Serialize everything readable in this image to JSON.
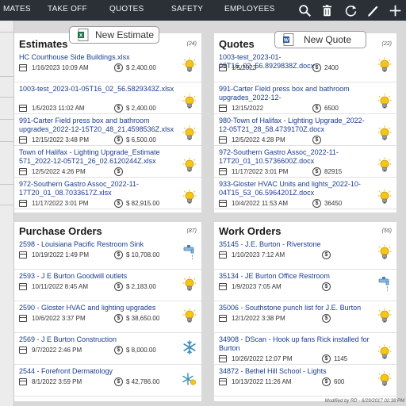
{
  "nav": {
    "tabs": [
      "MATES",
      "TAKE OFF",
      "QUOTES",
      "SAFETY",
      "EMPLOYEES"
    ],
    "icons": [
      "search-icon",
      "trash-icon",
      "refresh-icon",
      "pencil-icon",
      "plus-icon"
    ]
  },
  "estimates": {
    "title": "Estimates",
    "count": "(24)",
    "new_label": "New Estimate",
    "items": [
      {
        "title": "HC Courthouse Side Buildings.xlsx",
        "date": "1/16/2023 10:09 AM",
        "amount": "$ 2,400.00",
        "status": "lightbulb"
      },
      {
        "title": "1003-test_2023-01-05T16_02_56.5829343Z.xlsx",
        "date": "1/5/2023 11:02 AM",
        "amount": "$ 2,400.00",
        "status": "lightbulb"
      },
      {
        "title": "991-Carter Field press box and bathroom upgrades_2022-12-15T20_48_21.4598536Z.xlsx",
        "date": "12/15/2022 3:48 PM",
        "amount": "$ 6,500.00",
        "status": "lightbulb"
      },
      {
        "title": "Town of Halifax - Lighting Upgrade_Estimate 571_2022-12-05T21_26_02.6120244Z.xlsx",
        "date": "12/5/2022 4:26 PM",
        "amount": "",
        "status": "lightbulb"
      },
      {
        "title": "972-Southern Gastro Assoc_2022-11-17T20_01_08.7033617Z.xlsx",
        "date": "11/17/2022 3:01 PM",
        "amount": "$ 82,915.00",
        "status": "lightbulb"
      }
    ]
  },
  "quotes": {
    "title": "Quotes",
    "count": "(22)",
    "new_label": "New Quote",
    "items": [
      {
        "title": "1003-test_2023-01-05T16_02_56.8929838Z.docx",
        "date": "1/5/2023",
        "amount": "2400",
        "status": "lightbulb"
      },
      {
        "title": "991-Carter Field press box and bathroom upgrades_2022-12-15T20_48_21.4008509Z.docx",
        "date": "12/15/2022",
        "amount": "6500",
        "status": "lightbulb"
      },
      {
        "title": "980-Town of Halifax - Lighting Upgrade_2022-12-05T21_28_58.4739170Z.docx",
        "date": "12/5/2022 4:28 PM",
        "amount": "",
        "status": "lightbulb"
      },
      {
        "title": "972-Southern Gastro Assoc_2022-11-17T20_01_10.5736600Z.docx",
        "date": "11/17/2022 3:01 PM",
        "amount": "82915",
        "status": "lightbulb"
      },
      {
        "title": "933-Gloster HVAC Units and lights_2022-10-04T15_53_06.5964201Z.docx",
        "date": "10/4/2022 11:53 AM",
        "amount": "36450",
        "status": "lightbulb"
      }
    ]
  },
  "purchase_orders": {
    "title": "Purchase Orders",
    "count": "(87)",
    "items": [
      {
        "title": "2598 - Louisiana Pacific  Restroom Sink",
        "date": "10/19/2022 1:49 PM",
        "amount": "$ 10,708.00",
        "status": "faucet"
      },
      {
        "title": "2593 - J E Burton Goodwill outlets",
        "date": "10/11/2022 8:45 AM",
        "amount": "$ 2,183.00",
        "status": "lightbulb"
      },
      {
        "title": "2590 - Gloster HVAC and lighting upgrades",
        "date": "10/6/2022 3:37 PM",
        "amount": "$ 38,650.00",
        "status": "lightbulb"
      },
      {
        "title": "2569 - J E Burton Construction",
        "date": "9/7/2022 2:46 PM",
        "amount": "$ 8,000.00",
        "status": "snowflake"
      },
      {
        "title": "2544 - Forefront Dermatology",
        "date": "8/1/2022 3:59 PM",
        "amount": "$ 42,786.00",
        "status": "snowflake-sun"
      }
    ]
  },
  "work_orders": {
    "title": "Work Orders",
    "count": "(55)",
    "items": [
      {
        "title": "35145 - J.E. Burton - Riverstone",
        "date": "1/10/2023 7:12 AM",
        "amount": "",
        "status": "lightbulb"
      },
      {
        "title": "35134 - JE Burton Office  Restroom",
        "date": "1/9/2023 7:05 AM",
        "amount": "",
        "status": "faucet"
      },
      {
        "title": "35006 - Southstone punch list for J.E. Burton",
        "date": "12/1/2022 3:38 PM",
        "amount": "",
        "status": "lightbulb"
      },
      {
        "title": "34908 - DScan - Hook up fans Rick installed for Burton",
        "date": "10/26/2022 12:07 PM",
        "amount": "1145",
        "status": "lightbulb"
      },
      {
        "title": "34872 - Bethel Hill School - Lights",
        "date": "10/13/2022 11:26 AM",
        "amount": "600",
        "status": "lightbulb"
      }
    ]
  },
  "footer": {
    "text": "Modified by RD - 6/29/2017 02:38 PM"
  },
  "colors": {
    "nav_bg": "#2b2f36",
    "link": "#1a3d8f",
    "bulb": "#f2c12e",
    "snow": "#3a8fb7",
    "excel": "#1e7145",
    "word": "#2b579a"
  }
}
